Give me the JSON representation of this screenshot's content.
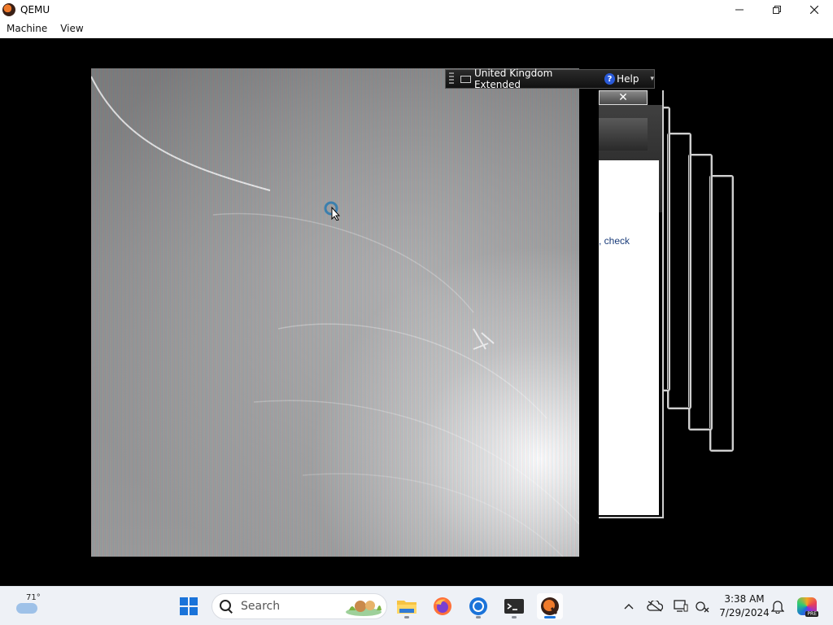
{
  "window": {
    "title": "QEMU",
    "controls": [
      "minimize-icon",
      "restore-icon",
      "close-icon"
    ]
  },
  "menu": {
    "items": [
      "Machine",
      "View"
    ]
  },
  "guest": {
    "language_bar": {
      "language": "United Kingdom Extended",
      "help_label": "Help"
    },
    "dialog": {
      "close_glyph": "✕",
      "partial_text": ", check"
    }
  },
  "taskbar": {
    "weather_temp": "71°",
    "search_placeholder": "Search",
    "apps": [
      "file-explorer-icon",
      "firefox-icon",
      "chrome-icon",
      "terminal-icon",
      "qemu-icon"
    ],
    "clock_time": "3:38 AM",
    "clock_date": "7/29/2024",
    "copilot_badge": "PRE"
  },
  "colors": {
    "start_blue": "#1a73d9",
    "taskbar_bg": "#eef1f6",
    "dialog_link_text": "#1a3c7a"
  }
}
